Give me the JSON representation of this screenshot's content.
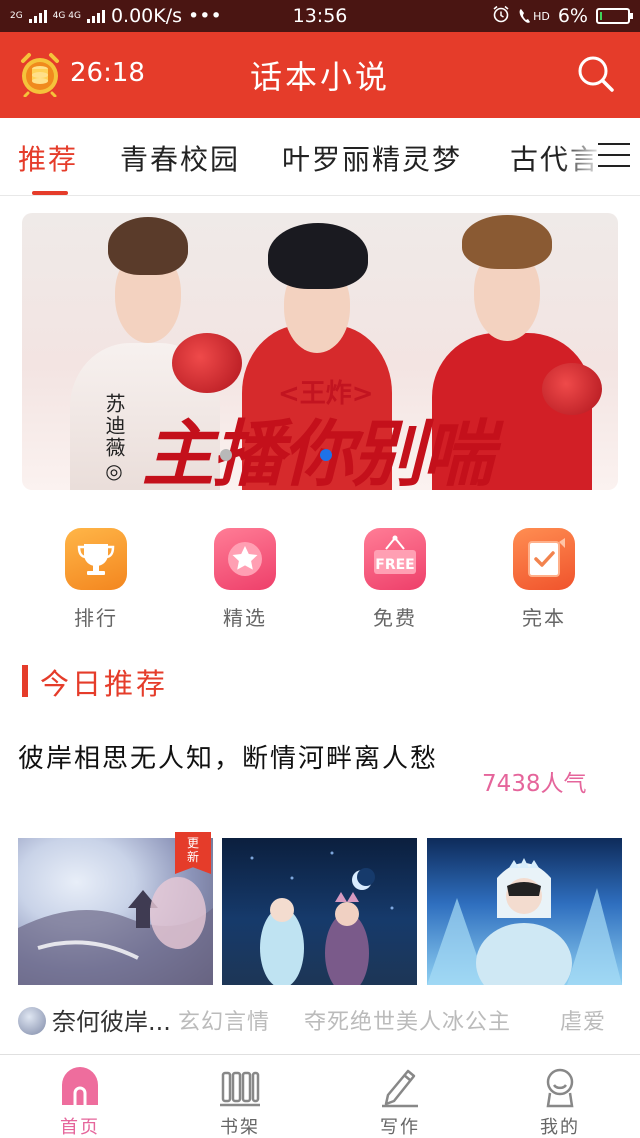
{
  "status_bar": {
    "network_left": "2G",
    "network_right": "4G 4G",
    "speed": "0.00K/s",
    "more": "•••",
    "time": "13:56",
    "hd": "HD",
    "battery": "6%",
    "battery_level": 0.06
  },
  "header": {
    "timer": "26:18",
    "title": "话本小说"
  },
  "tabs": [
    {
      "label": "推荐",
      "active": true
    },
    {
      "label": "青春校园",
      "active": false
    },
    {
      "label": "叶罗丽精灵梦",
      "active": false
    },
    {
      "label": "古代言",
      "active": false
    }
  ],
  "banner": {
    "author": "苏迪薇◎",
    "subtitle": "<王炸>",
    "title": "主播你别喘",
    "page_count": 2,
    "active_page": 1
  },
  "quick_nav": [
    {
      "label": "排行",
      "icon": "trophy-icon",
      "color": "#f59a27"
    },
    {
      "label": "精选",
      "icon": "star-icon",
      "color": "#f2577f"
    },
    {
      "label": "免费",
      "icon": "free-tag-icon",
      "color": "#f2577f",
      "icon_text": "FREE"
    },
    {
      "label": "完本",
      "icon": "completed-book-icon",
      "color": "#f56a3a"
    }
  ],
  "section": {
    "title": "今日推荐"
  },
  "recommendation": {
    "title": "彼岸相思无人知，断情河畔离人愁",
    "popularity": "7438人气",
    "badge": "更新",
    "author": "奈何彼岸...",
    "tags": [
      "玄幻言情",
      "夺死绝世美人冰公主",
      "虐爱"
    ]
  },
  "bottom_nav": [
    {
      "label": "首页",
      "icon": "home-icon",
      "active": true
    },
    {
      "label": "书架",
      "icon": "bookshelf-icon",
      "active": false
    },
    {
      "label": "写作",
      "icon": "pen-icon",
      "active": false
    },
    {
      "label": "我的",
      "icon": "profile-icon",
      "active": false
    }
  ],
  "colors": {
    "brand_red": "#e53c2a",
    "status_bar": "#4a1512",
    "popularity_pink": "#e5659b",
    "banner_dot_active": "#1e72e8"
  }
}
